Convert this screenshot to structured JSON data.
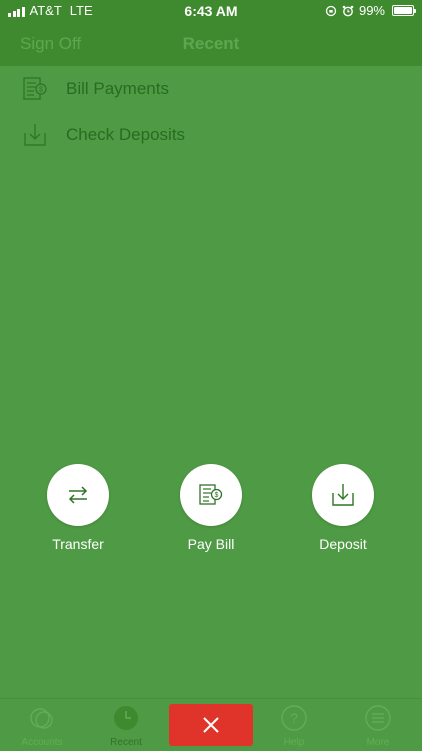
{
  "status_bar": {
    "carrier": "AT&T",
    "network": "LTE",
    "time": "6:43 AM",
    "battery": "99%",
    "battery_level": 0.99
  },
  "nav": {
    "left_label": "Sign Off",
    "title": "Recent"
  },
  "recent_items": [
    {
      "label": "Bill Payments",
      "icon": "bill-payment-icon"
    },
    {
      "label": "Check Deposits",
      "icon": "check-deposit-icon"
    }
  ],
  "actions": [
    {
      "label": "Transfer",
      "icon": "transfer-icon"
    },
    {
      "label": "Pay Bill",
      "icon": "pay-bill-icon"
    },
    {
      "label": "Deposit",
      "icon": "deposit-icon"
    }
  ],
  "tabs": [
    {
      "label": "Accounts",
      "icon": "accounts-icon"
    },
    {
      "label": "Recent",
      "icon": "recent-clock-icon",
      "active": true
    },
    {
      "label": "Help",
      "icon": "help-icon"
    },
    {
      "label": "More",
      "icon": "more-menu-icon"
    }
  ],
  "colors": {
    "background": "#4f9b45",
    "header": "#3f8a2f",
    "close_button": "#e0342b"
  }
}
